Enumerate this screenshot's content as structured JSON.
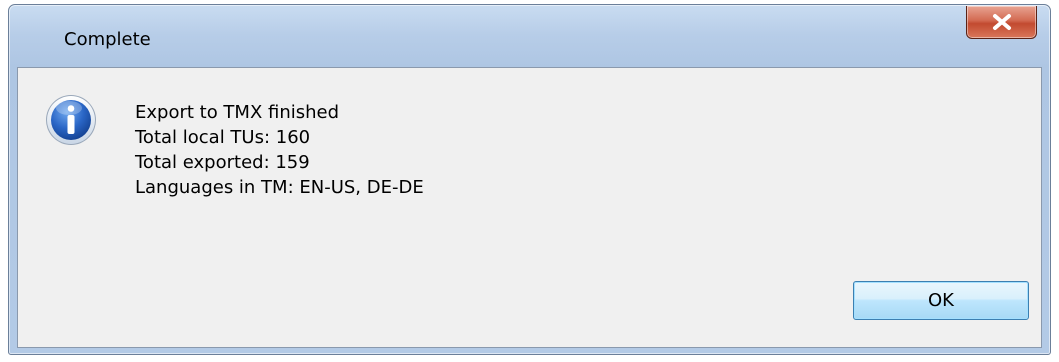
{
  "dialog": {
    "title": "Complete",
    "close_icon": "close-icon",
    "info_icon": "info-icon",
    "message_lines": [
      "Export to TMX finished",
      "Total local TUs: 160",
      "Total exported: 159",
      "Languages in TM: EN-US, DE-DE"
    ],
    "ok_label": "OK",
    "colors": {
      "close_button": "#c24a30",
      "info_icon": "#1f5fbf",
      "ok_button_border": "#3c7fb1",
      "client_background": "#f0f0f0"
    }
  }
}
